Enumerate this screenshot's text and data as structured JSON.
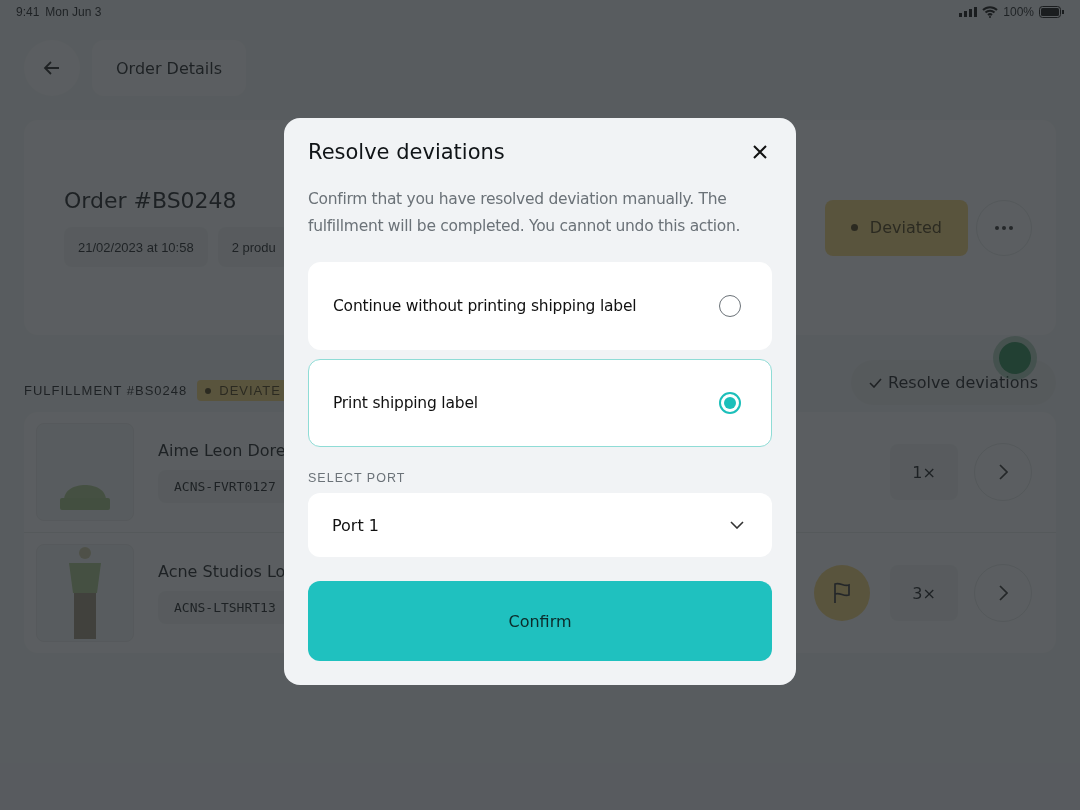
{
  "status_bar": {
    "time": "9:41",
    "date": "Mon Jun 3",
    "battery": "100%"
  },
  "header": {
    "title": "Order Details"
  },
  "order": {
    "title": "Order #BS0248",
    "chips": [
      "21/02/2023 at 10:58",
      "2 produ"
    ],
    "status": "Deviated"
  },
  "fulfillment": {
    "title": "FULFILLMENT #BS0248",
    "status": "DEVIATE",
    "action": "Resolve deviations",
    "items": [
      {
        "name": "Aime Leon Dore",
        "sku": "ACNS-FVRT0127",
        "quantity": "1×",
        "kind": "beanie",
        "flagged": false
      },
      {
        "name": "Acne Studios Lo",
        "sku": "ACNS-LTSHRT13",
        "quantity": "3×",
        "kind": "outfit",
        "flagged": true
      }
    ]
  },
  "dialog": {
    "title": "Resolve deviations",
    "message": "Confirm that you have resolved deviation manually. The fulfillment will be completed. You cannot undo this action.",
    "options": [
      {
        "label": "Continue without printing shipping label",
        "selected": false
      },
      {
        "label": "Print shipping label",
        "selected": true
      }
    ],
    "port_label": "SELECT PORT",
    "port": {
      "value": "Port 1"
    },
    "confirm": "Confirm"
  }
}
